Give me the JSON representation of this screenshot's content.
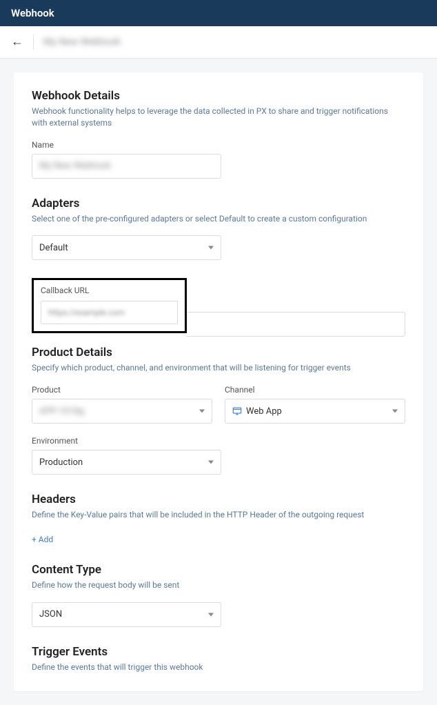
{
  "topbar": {
    "title": "Webhook"
  },
  "breadcrumb": {
    "name": "My New Webhook"
  },
  "details": {
    "title": "Webhook Details",
    "desc": "Webhook functionality helps to leverage the data collected in PX to share and trigger notifications with external systems",
    "name_label": "Name",
    "name_value": "My New Webhook"
  },
  "adapters": {
    "title": "Adapters",
    "desc": "Select one of the pre-configured adapters or select Default to create a custom configuration",
    "value": "Default"
  },
  "callback": {
    "label": "Callback URL",
    "value": "https://example.com"
  },
  "product_details": {
    "title": "Product Details",
    "desc": "Specify which product, channel, and environment that will be listening for trigger events",
    "product_label": "Product",
    "product_value": "APP-1018g",
    "channel_label": "Channel",
    "channel_value": "Web App",
    "env_label": "Environment",
    "env_value": "Production"
  },
  "headers": {
    "title": "Headers",
    "desc": "Define the Key-Value pairs that will be included in the HTTP Header of the outgoing request",
    "add": "+ Add"
  },
  "content_type": {
    "title": "Content Type",
    "desc": "Define how the request body will be sent",
    "value": "JSON"
  },
  "trigger": {
    "title": "Trigger Events",
    "desc": "Define the events that will trigger this webhook"
  }
}
